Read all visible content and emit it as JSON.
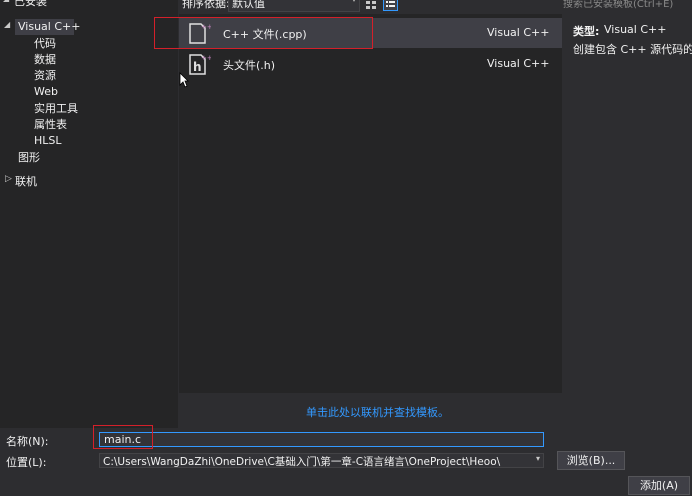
{
  "left_tree": {
    "installed_label": "已安装",
    "visual_cpp": "Visual C++",
    "children": [
      "代码",
      "数据",
      "资源",
      "Web",
      "实用工具",
      "属性表",
      "HLSL"
    ],
    "graphics": "图形",
    "online": "联机"
  },
  "sort_bar": {
    "sort_label": "排序依据:",
    "sort_value": "默认值"
  },
  "search": {
    "placeholder": "搜索已安装模板(Ctrl+E)"
  },
  "templates": [
    {
      "name": "C++ 文件(.cpp)",
      "lang": "Visual C++"
    },
    {
      "name": "头文件(.h)",
      "lang": "Visual C++"
    }
  ],
  "details": {
    "type_label": "类型:",
    "type_value": "Visual C++",
    "description": "创建包含 C++ 源代码的文件"
  },
  "online_link": "单击此处以联机并查找模板。",
  "form": {
    "name_label": "名称(N):",
    "name_value": "main.c",
    "location_label": "位置(L):",
    "location_value": "C:\\Users\\WangDaZhi\\OneDrive\\C基础入门\\第一章-C语言绪言\\OneProject\\Heoo\\",
    "browse_label": "浏览(B)...",
    "add_label": "添加(A)"
  },
  "colors": {
    "accent": "#3399ff",
    "highlight": "#d4202a",
    "link": "#3399ff"
  }
}
